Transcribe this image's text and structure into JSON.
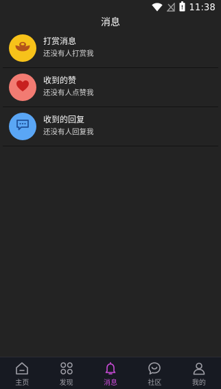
{
  "status_bar": {
    "time": "11:38",
    "icons": [
      "wifi-icon",
      "signal-off-icon",
      "battery-icon"
    ]
  },
  "header": {
    "title": "消息"
  },
  "messages": [
    {
      "title": "打赏消息",
      "subtitle": "还没有人打赏我",
      "icon": "gold-ingot-icon",
      "color": "#f7c21a"
    },
    {
      "title": "收到的赞",
      "subtitle": "还没有人点赞我",
      "icon": "heart-icon",
      "color": "#f27b72"
    },
    {
      "title": "收到的回复",
      "subtitle": "还没有人回复我",
      "icon": "chat-bubble-icon",
      "color": "#5aa6f5"
    }
  ],
  "tabs": [
    {
      "label": "主页",
      "icon": "home-icon",
      "active": false
    },
    {
      "label": "发现",
      "icon": "discover-icon",
      "active": false
    },
    {
      "label": "消息",
      "icon": "bell-icon",
      "active": true
    },
    {
      "label": "社区",
      "icon": "community-icon",
      "active": false
    },
    {
      "label": "我的",
      "icon": "profile-icon",
      "active": false
    }
  ],
  "colors": {
    "background": "#232323",
    "tab_bar": "#171a22",
    "active_tab": "#c94bd6",
    "inactive_tab": "#a0a0a8"
  }
}
